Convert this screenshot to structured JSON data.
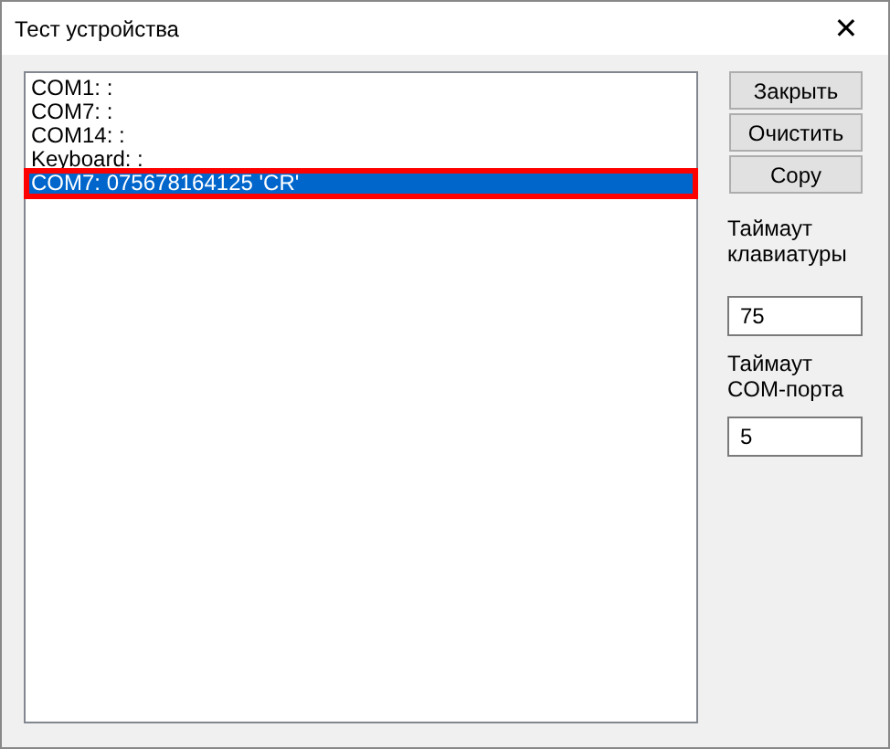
{
  "window": {
    "title": "Тест устройства",
    "close": "✕"
  },
  "log": [
    {
      "text": "COM1: :",
      "selected": false,
      "outlined": false
    },
    {
      "text": "COM7: :",
      "selected": false,
      "outlined": false
    },
    {
      "text": "COM14: :",
      "selected": false,
      "outlined": false
    },
    {
      "text": "Keyboard: :",
      "selected": false,
      "outlined": false
    },
    {
      "text": "COM7: 075678164125 'CR'",
      "selected": true,
      "outlined": true
    }
  ],
  "buttons": [
    "Закрыть",
    "Очистить",
    "Copy"
  ],
  "fields": [
    {
      "label": "Таймаут клавиатуры",
      "value": "75"
    },
    {
      "label": "Таймаут COM-порта",
      "value": "5"
    }
  ]
}
